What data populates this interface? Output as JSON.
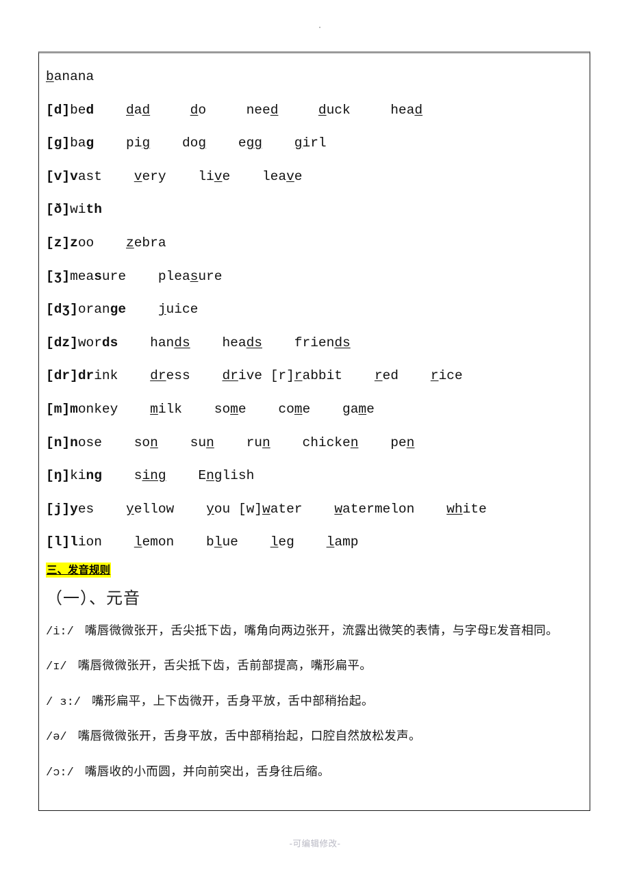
{
  "document": {
    "footer_note": "-可编辑修改-",
    "highlight_color": "#ffff00",
    "border_color": "#1a1a1a"
  },
  "consonant_rows": [
    {
      "symbol": "",
      "prefix": "",
      "words": [
        {
          "text": "banana",
          "mark_start": 0,
          "mark_end": 1,
          "style": "underline"
        }
      ]
    },
    {
      "symbol": "[d]",
      "symbol_letter": "d",
      "words": [
        {
          "text": "bed",
          "mark_start": 2,
          "mark_end": 3,
          "style": "bold"
        },
        {
          "text": "dad",
          "marks": "0-1,2-3",
          "style": "underline"
        },
        {
          "text": "do",
          "mark_start": 0,
          "mark_end": 1,
          "style": "underline"
        },
        {
          "text": "need",
          "mark_start": 3,
          "mark_end": 4,
          "style": "underline"
        },
        {
          "text": "duck",
          "mark_start": 0,
          "mark_end": 1,
          "style": "underline"
        },
        {
          "text": "head",
          "mark_start": 3,
          "mark_end": 4,
          "style": "underline"
        }
      ]
    },
    {
      "symbol": "[g]",
      "symbol_letter": "g",
      "words": [
        {
          "text": "bag",
          "mark_start": 2,
          "mark_end": 3,
          "style": "bold"
        },
        {
          "text": "pig",
          "mark_start": 2,
          "mark_end": 3,
          "style": "underline"
        },
        {
          "text": "dog",
          "mark_start": 2,
          "mark_end": 3,
          "style": "underline"
        },
        {
          "text": "egg",
          "mark_start": 1,
          "mark_end": 3,
          "style": "underline"
        },
        {
          "text": "girl",
          "mark_start": 0,
          "mark_end": 1,
          "style": "underline"
        }
      ]
    },
    {
      "symbol": "[v]",
      "symbol_letter": "v",
      "words": [
        {
          "text": "vast",
          "mark_start": 0,
          "mark_end": 1,
          "style": "bold"
        },
        {
          "text": "very",
          "mark_start": 0,
          "mark_end": 1,
          "style": "underline"
        },
        {
          "text": "live",
          "mark_start": 2,
          "mark_end": 3,
          "style": "underline"
        },
        {
          "text": "leave",
          "mark_start": 3,
          "mark_end": 4,
          "style": "underline"
        }
      ]
    },
    {
      "symbol": "[ð]",
      "symbol_letter": "ð",
      "words": [
        {
          "text": "with",
          "mark_start": 2,
          "mark_end": 4,
          "style": "bold"
        }
      ]
    },
    {
      "symbol": "[z]",
      "symbol_letter": "z",
      "words": [
        {
          "text": "zoo",
          "mark_start": 0,
          "mark_end": 1,
          "style": "bold"
        },
        {
          "text": "zebra",
          "mark_start": 0,
          "mark_end": 1,
          "style": "underline"
        }
      ]
    },
    {
      "symbol": "[ʒ]",
      "symbol_letter": "ʒ",
      "words": [
        {
          "text": "measure",
          "mark_start": 3,
          "mark_end": 4,
          "style": "bold"
        },
        {
          "text": "pleasure",
          "mark_start": 4,
          "mark_end": 5,
          "style": "underline"
        }
      ]
    },
    {
      "symbol": "[dʒ]",
      "symbol_letter": "dʒ",
      "words": [
        {
          "text": "orange",
          "mark_start": 4,
          "mark_end": 6,
          "style": "bold"
        },
        {
          "text": "juice",
          "mark_start": 0,
          "mark_end": 1,
          "style": "underline"
        }
      ]
    },
    {
      "symbol": "[dz]",
      "symbol_letter": "dz",
      "words": [
        {
          "text": "words",
          "mark_start": 3,
          "mark_end": 5,
          "style": "bold"
        },
        {
          "text": "hands",
          "mark_start": 3,
          "mark_end": 5,
          "style": "underline"
        },
        {
          "text": "heads",
          "mark_start": 3,
          "mark_end": 5,
          "style": "underline"
        },
        {
          "text": "friends",
          "mark_start": 5,
          "mark_end": 7,
          "style": "underline"
        }
      ]
    },
    {
      "symbol": "[dr]",
      "symbol_letter": "dr",
      "words": [
        {
          "text": "drink",
          "mark_start": 0,
          "mark_end": 2,
          "style": "bold"
        },
        {
          "text": "dress",
          "mark_start": 0,
          "mark_end": 2,
          "style": "underline"
        },
        {
          "text": "drive",
          "mark_start": 0,
          "mark_end": 2,
          "style": "underline"
        }
      ],
      "inline_symbol": "[r]",
      "inline_words": [
        {
          "text": "rabbit",
          "mark_start": 0,
          "mark_end": 1,
          "style": "underline"
        },
        {
          "text": "red",
          "mark_start": 0,
          "mark_end": 1,
          "style": "underline"
        },
        {
          "text": "rice",
          "mark_start": 0,
          "mark_end": 1,
          "style": "underline"
        }
      ]
    },
    {
      "symbol": "[m]",
      "symbol_letter": "m",
      "words": [
        {
          "text": "monkey",
          "mark_start": 0,
          "mark_end": 1,
          "style": "bold"
        },
        {
          "text": "milk",
          "mark_start": 0,
          "mark_end": 1,
          "style": "underline"
        },
        {
          "text": "some",
          "mark_start": 2,
          "mark_end": 3,
          "style": "underline"
        },
        {
          "text": "come",
          "mark_start": 2,
          "mark_end": 3,
          "style": "underline"
        },
        {
          "text": "game",
          "mark_start": 2,
          "mark_end": 3,
          "style": "underline"
        }
      ]
    },
    {
      "symbol": "[n]",
      "symbol_letter": "n",
      "words": [
        {
          "text": "nose",
          "mark_start": 0,
          "mark_end": 1,
          "style": "bold"
        },
        {
          "text": "son",
          "mark_start": 2,
          "mark_end": 3,
          "style": "underline"
        },
        {
          "text": "sun",
          "mark_start": 2,
          "mark_end": 3,
          "style": "underline"
        },
        {
          "text": "run",
          "mark_start": 2,
          "mark_end": 3,
          "style": "underline"
        },
        {
          "text": "chicken",
          "mark_start": 6,
          "mark_end": 7,
          "style": "underline"
        },
        {
          "text": "pen",
          "mark_start": 2,
          "mark_end": 3,
          "style": "underline"
        }
      ]
    },
    {
      "symbol": "[ŋ]",
      "symbol_letter": "ŋ",
      "words": [
        {
          "text": "king",
          "mark_start": 2,
          "mark_end": 4,
          "style": "bold"
        },
        {
          "text": "sing",
          "mark_start": 1,
          "mark_end": 4,
          "style": "underline"
        },
        {
          "text": "English",
          "mark_start": 1,
          "mark_end": 2,
          "style": "underline"
        }
      ]
    },
    {
      "symbol": "[j]",
      "symbol_letter": "j",
      "words": [
        {
          "text": "yes",
          "mark_start": 0,
          "mark_end": 1,
          "style": "bold"
        },
        {
          "text": "yellow",
          "mark_start": 0,
          "mark_end": 1,
          "style": "underline"
        },
        {
          "text": "you",
          "mark_start": 0,
          "mark_end": 1,
          "style": "underline"
        }
      ],
      "inline_symbol": "[w]",
      "inline_words": [
        {
          "text": "water",
          "mark_start": 0,
          "mark_end": 1,
          "style": "underline"
        },
        {
          "text": "watermelon",
          "mark_start": 0,
          "mark_end": 1,
          "style": "underline"
        },
        {
          "text": "white",
          "mark_start": 0,
          "mark_end": 2,
          "style": "underline"
        }
      ]
    },
    {
      "symbol": "[l]",
      "symbol_letter": "l",
      "words": [
        {
          "text": "lion",
          "mark_start": 0,
          "mark_end": 1,
          "style": "bold"
        },
        {
          "text": "lemon",
          "mark_start": 0,
          "mark_end": 1,
          "style": "underline"
        },
        {
          "text": "blue",
          "mark_start": 1,
          "mark_end": 2,
          "style": "underline"
        },
        {
          "text": "leg",
          "mark_start": 0,
          "mark_end": 1,
          "style": "underline"
        },
        {
          "text": "lamp",
          "mark_start": 0,
          "mark_end": 1,
          "style": "underline"
        }
      ]
    }
  ],
  "lines": {
    "banana": "banana",
    "row_d": "[d]bed    dad     do     need     duck     head",
    "row_g": "[g]bag    pig    dog    egg    girl",
    "row_v": "[v]vast    very    live    leave",
    "row_eth": "[ð]with",
    "row_z": "[z]zoo    zebra",
    "row_zh": "[ʒ]measure    pleasure",
    "row_dzh": "[dʒ]orange    juice",
    "row_dz": "[dz]words    hands    heads    friends",
    "row_dr": "[dr]drink    dress    drive [r]rabbit    red    rice",
    "row_m": "[m]monkey    milk    some    come    game",
    "row_n": "[n]nose    son    sun    run    chicken    pen",
    "row_ng": "[ŋ]king    sing    English",
    "row_j": "[j]yes    yellow    you [w]water    watermelon    white",
    "row_l": "[l]lion    lemon    blue    leg    lamp"
  },
  "section": {
    "heading": "三、发音规则",
    "subheading": "（一）、元音"
  },
  "vowels": [
    {
      "ipa": "/i:/",
      "description": "嘴唇微微张开，舌尖抵下齿，嘴角向两边张开，流露出微笑的表情，与字母E发音相同。"
    },
    {
      "ipa": "/ɪ/",
      "description": "嘴唇微微张开，舌尖抵下齿，舌前部提高，嘴形扁平。"
    },
    {
      "ipa": "/ ɜ:/",
      "description": "嘴形扁平，上下齿微开，舌身平放，舌中部稍抬起。"
    },
    {
      "ipa": "/ə/",
      "description": "嘴唇微微张开，舌身平放，舌中部稍抬起，口腔自然放松发声。"
    },
    {
      "ipa": "/ɔ:/",
      "description": "嘴唇收的小而圆，并向前突出，舌身往后缩。"
    }
  ]
}
